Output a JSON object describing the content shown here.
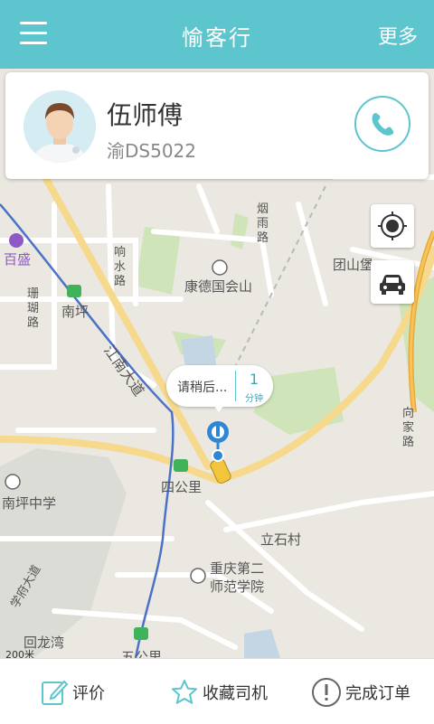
{
  "header": {
    "title": "愉客行",
    "more_label": "更多"
  },
  "driver": {
    "name": "伍师傅",
    "plate": "渝DS5022"
  },
  "eta_bubble": {
    "text": "请稍后...",
    "minutes": "1",
    "unit": "分钟"
  },
  "map_labels": {
    "baisheng": "百盛",
    "xushui_road": "响水路",
    "yanyu_road": "烟雨路",
    "kangde": "康德国会山",
    "tuanshan": "团山堡",
    "shanhu_road": "珊瑚路",
    "nanping": "南坪",
    "jiangnan_ave": "江南大道",
    "xiangjia_road": "向家路",
    "sigongli": "四公里",
    "nanping_middle": "南坪中学",
    "lishicun": "立石村",
    "chongqing_normal": "重庆第二师范学院",
    "huilongwan": "回龙湾",
    "wugongli": "五公里",
    "scale": "200米",
    "road_sw": "学府大道"
  },
  "bottom_bar": {
    "rate": "评价",
    "favorite": "收藏司机",
    "complete": "完成订单"
  },
  "colors": {
    "accent": "#5cc5cd",
    "map_bg": "#ebe8e1",
    "road_main": "#f6d98c",
    "river_line": "#4a72c8"
  },
  "icons": [
    "menu-icon",
    "phone-icon",
    "locate-icon",
    "taxi-icon",
    "edit-icon",
    "star-icon",
    "alert-icon"
  ]
}
